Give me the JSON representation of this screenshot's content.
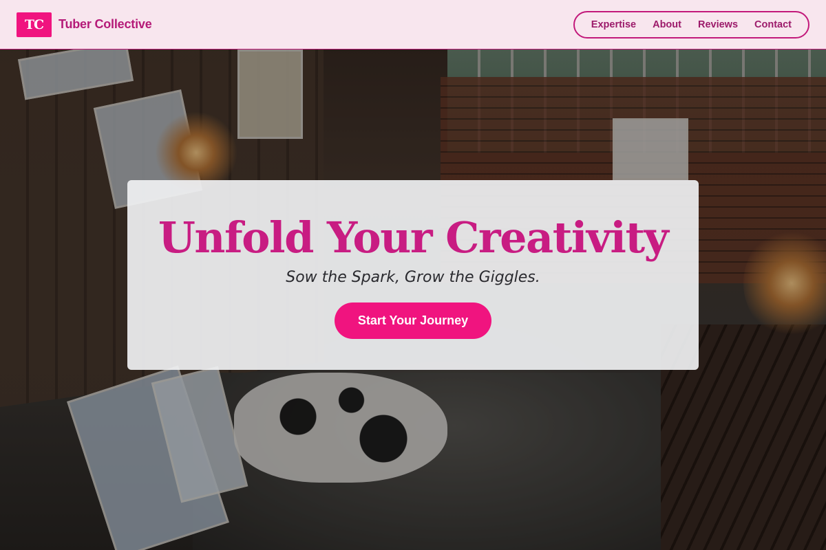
{
  "header": {
    "logo_text": "TC",
    "brand_name": "Tuber Collective",
    "nav": [
      {
        "label": "Expertise"
      },
      {
        "label": "About"
      },
      {
        "label": "Reviews"
      },
      {
        "label": "Contact"
      }
    ]
  },
  "hero": {
    "background_image": "art studio interior with canvases, brick wall, windows, chandeliers and cowhide rug",
    "title": "Unfold Your Creativity",
    "subtitle": "Sow the Spark, Grow the Giggles.",
    "cta_label": "Start Your Journey"
  },
  "colors": {
    "accent": "#f0147f",
    "title": "#c81c82",
    "header_bg": "#f8e6ee",
    "nav_text": "#9c1a6a"
  }
}
